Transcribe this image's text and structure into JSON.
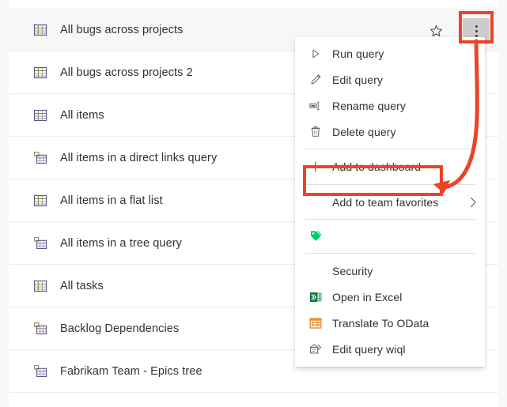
{
  "app": {
    "surface": "query-list",
    "accent_red": "#ed4326",
    "row_selected_bg": "#f7f7f7",
    "menu_bg": "#ffffff"
  },
  "query_list": {
    "rows": [
      {
        "label": "All bugs across projects",
        "icon": "grid-flat-query-icon",
        "selected": true
      },
      {
        "label": "All bugs across projects 2",
        "icon": "grid-flat-query-icon",
        "selected": false
      },
      {
        "label": "All items",
        "icon": "grid-flat-query-icon",
        "selected": false
      },
      {
        "label": "All items in a direct links query",
        "icon": "grid-links-query-icon",
        "selected": false
      },
      {
        "label": "All items in a flat list",
        "icon": "grid-flat-query-icon",
        "selected": false
      },
      {
        "label": "All items in a tree query",
        "icon": "grid-tree-query-icon",
        "selected": false
      },
      {
        "label": "All tasks",
        "icon": "grid-flat-query-icon",
        "selected": false
      },
      {
        "label": "Backlog Dependencies",
        "icon": "grid-links-query-icon",
        "selected": false
      },
      {
        "label": "Fabrikam Team - Epics tree",
        "icon": "grid-tree-query-icon",
        "selected": false
      }
    ],
    "row_actions": {
      "favorite_icon": "star-outline-icon",
      "more_icon": "ellipsis-vertical-icon"
    }
  },
  "context_menu": {
    "items": [
      {
        "label": "Run query",
        "icon": "play-triangle-icon",
        "type": "item"
      },
      {
        "label": "Edit query",
        "icon": "pencil-icon",
        "type": "item"
      },
      {
        "label": "Rename query",
        "icon": "rename-icon",
        "type": "item"
      },
      {
        "label": "Delete query",
        "icon": "trash-icon",
        "type": "item"
      },
      {
        "type": "divider"
      },
      {
        "label": "Add to dashboard",
        "icon": "plus-icon",
        "type": "item",
        "highlighted": true
      },
      {
        "type": "divider"
      },
      {
        "label": "Add to team favorites",
        "icon": "none",
        "type": "submenu",
        "chevron": "›"
      },
      {
        "type": "divider"
      },
      {
        "label": "",
        "icon": "green-tag-icon",
        "type": "item"
      },
      {
        "type": "divider"
      },
      {
        "label": "Security",
        "icon": "none",
        "type": "item"
      },
      {
        "label": "Open in Excel",
        "icon": "excel-icon",
        "type": "item"
      },
      {
        "label": "Translate To OData",
        "icon": "odata-icon",
        "type": "item"
      },
      {
        "label": "Edit query wiql",
        "icon": "wiql-icon",
        "type": "item"
      }
    ]
  },
  "annotations": {
    "color": "#ed4326",
    "ellipsis_highlight": "ellipsis-vertical-button",
    "dashboard_highlight": "Add to dashboard",
    "arrow": "curved-arrow-from-ellipsis-to-add-to-dashboard"
  }
}
